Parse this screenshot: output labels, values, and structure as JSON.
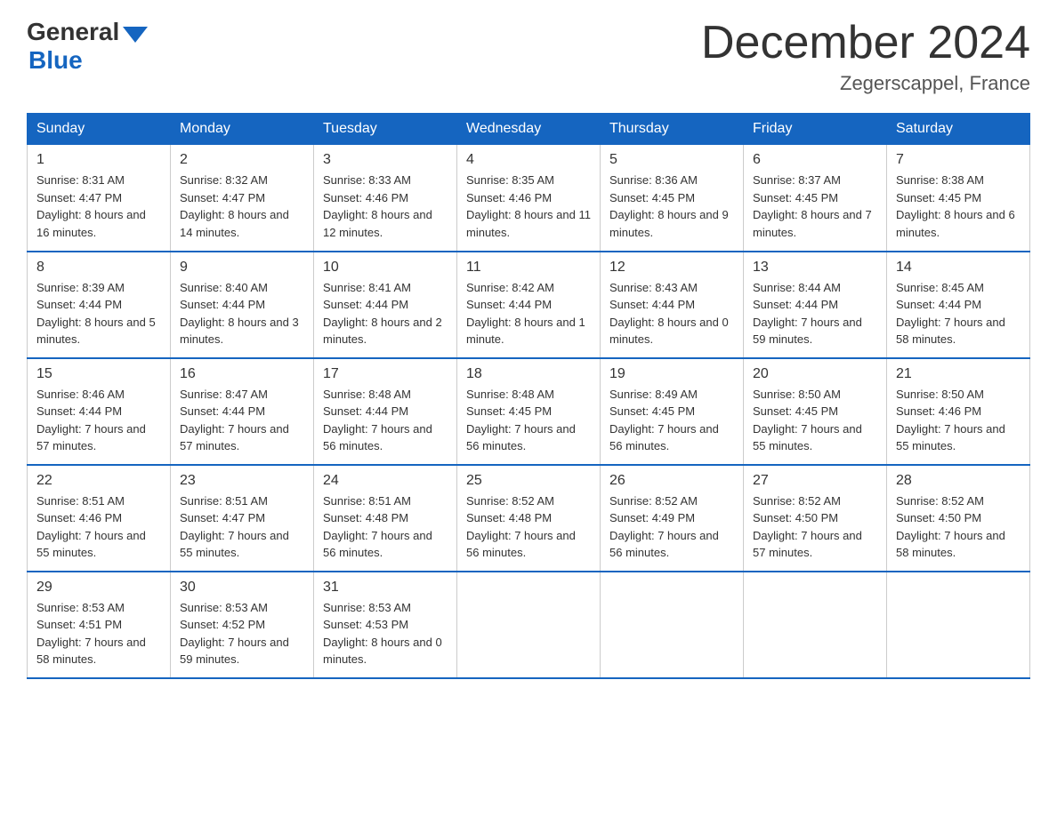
{
  "logo": {
    "general": "General",
    "blue": "Blue",
    "arrow": "▼"
  },
  "title": "December 2024",
  "subtitle": "Zegerscappel, France",
  "days_of_week": [
    "Sunday",
    "Monday",
    "Tuesday",
    "Wednesday",
    "Thursday",
    "Friday",
    "Saturday"
  ],
  "weeks": [
    [
      {
        "day": "1",
        "sunrise": "8:31 AM",
        "sunset": "4:47 PM",
        "daylight": "8 hours and 16 minutes."
      },
      {
        "day": "2",
        "sunrise": "8:32 AM",
        "sunset": "4:47 PM",
        "daylight": "8 hours and 14 minutes."
      },
      {
        "day": "3",
        "sunrise": "8:33 AM",
        "sunset": "4:46 PM",
        "daylight": "8 hours and 12 minutes."
      },
      {
        "day": "4",
        "sunrise": "8:35 AM",
        "sunset": "4:46 PM",
        "daylight": "8 hours and 11 minutes."
      },
      {
        "day": "5",
        "sunrise": "8:36 AM",
        "sunset": "4:45 PM",
        "daylight": "8 hours and 9 minutes."
      },
      {
        "day": "6",
        "sunrise": "8:37 AM",
        "sunset": "4:45 PM",
        "daylight": "8 hours and 7 minutes."
      },
      {
        "day": "7",
        "sunrise": "8:38 AM",
        "sunset": "4:45 PM",
        "daylight": "8 hours and 6 minutes."
      }
    ],
    [
      {
        "day": "8",
        "sunrise": "8:39 AM",
        "sunset": "4:44 PM",
        "daylight": "8 hours and 5 minutes."
      },
      {
        "day": "9",
        "sunrise": "8:40 AM",
        "sunset": "4:44 PM",
        "daylight": "8 hours and 3 minutes."
      },
      {
        "day": "10",
        "sunrise": "8:41 AM",
        "sunset": "4:44 PM",
        "daylight": "8 hours and 2 minutes."
      },
      {
        "day": "11",
        "sunrise": "8:42 AM",
        "sunset": "4:44 PM",
        "daylight": "8 hours and 1 minute."
      },
      {
        "day": "12",
        "sunrise": "8:43 AM",
        "sunset": "4:44 PM",
        "daylight": "8 hours and 0 minutes."
      },
      {
        "day": "13",
        "sunrise": "8:44 AM",
        "sunset": "4:44 PM",
        "daylight": "7 hours and 59 minutes."
      },
      {
        "day": "14",
        "sunrise": "8:45 AM",
        "sunset": "4:44 PM",
        "daylight": "7 hours and 58 minutes."
      }
    ],
    [
      {
        "day": "15",
        "sunrise": "8:46 AM",
        "sunset": "4:44 PM",
        "daylight": "7 hours and 57 minutes."
      },
      {
        "day": "16",
        "sunrise": "8:47 AM",
        "sunset": "4:44 PM",
        "daylight": "7 hours and 57 minutes."
      },
      {
        "day": "17",
        "sunrise": "8:48 AM",
        "sunset": "4:44 PM",
        "daylight": "7 hours and 56 minutes."
      },
      {
        "day": "18",
        "sunrise": "8:48 AM",
        "sunset": "4:45 PM",
        "daylight": "7 hours and 56 minutes."
      },
      {
        "day": "19",
        "sunrise": "8:49 AM",
        "sunset": "4:45 PM",
        "daylight": "7 hours and 56 minutes."
      },
      {
        "day": "20",
        "sunrise": "8:50 AM",
        "sunset": "4:45 PM",
        "daylight": "7 hours and 55 minutes."
      },
      {
        "day": "21",
        "sunrise": "8:50 AM",
        "sunset": "4:46 PM",
        "daylight": "7 hours and 55 minutes."
      }
    ],
    [
      {
        "day": "22",
        "sunrise": "8:51 AM",
        "sunset": "4:46 PM",
        "daylight": "7 hours and 55 minutes."
      },
      {
        "day": "23",
        "sunrise": "8:51 AM",
        "sunset": "4:47 PM",
        "daylight": "7 hours and 55 minutes."
      },
      {
        "day": "24",
        "sunrise": "8:51 AM",
        "sunset": "4:48 PM",
        "daylight": "7 hours and 56 minutes."
      },
      {
        "day": "25",
        "sunrise": "8:52 AM",
        "sunset": "4:48 PM",
        "daylight": "7 hours and 56 minutes."
      },
      {
        "day": "26",
        "sunrise": "8:52 AM",
        "sunset": "4:49 PM",
        "daylight": "7 hours and 56 minutes."
      },
      {
        "day": "27",
        "sunrise": "8:52 AM",
        "sunset": "4:50 PM",
        "daylight": "7 hours and 57 minutes."
      },
      {
        "day": "28",
        "sunrise": "8:52 AM",
        "sunset": "4:50 PM",
        "daylight": "7 hours and 58 minutes."
      }
    ],
    [
      {
        "day": "29",
        "sunrise": "8:53 AM",
        "sunset": "4:51 PM",
        "daylight": "7 hours and 58 minutes."
      },
      {
        "day": "30",
        "sunrise": "8:53 AM",
        "sunset": "4:52 PM",
        "daylight": "7 hours and 59 minutes."
      },
      {
        "day": "31",
        "sunrise": "8:53 AM",
        "sunset": "4:53 PM",
        "daylight": "8 hours and 0 minutes."
      },
      null,
      null,
      null,
      null
    ]
  ]
}
